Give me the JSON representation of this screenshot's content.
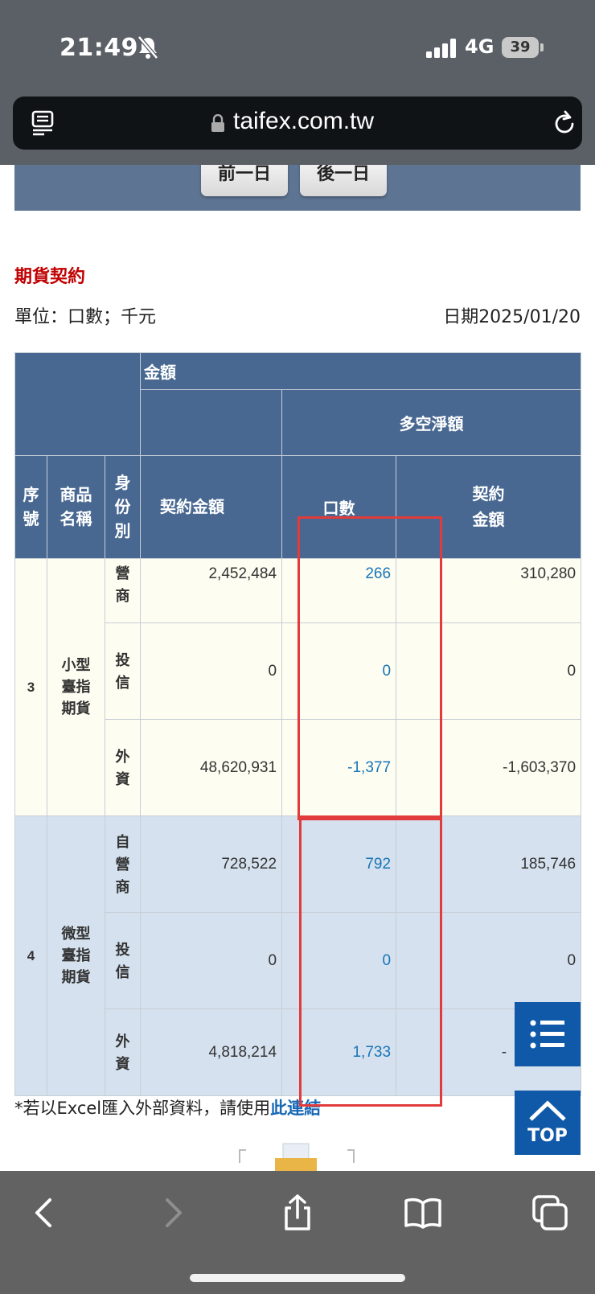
{
  "status": {
    "time": "21:49",
    "network": "4G",
    "battery": "39"
  },
  "browser": {
    "url": "taifex.com.tw"
  },
  "nav": {
    "prev_label": "前一日",
    "next_label": "後一日"
  },
  "page": {
    "section_title": "期貨契約",
    "unit_label": "單位：口數；千元",
    "date_label": "日期2025/01/20"
  },
  "table": {
    "header": {
      "amount": "金額",
      "net": "多空淨額",
      "seq": "序號",
      "product": "商品名稱",
      "identity": "身份別",
      "contract_amount": "契約金額",
      "lots": "口數",
      "net_contract_amount": "契約金額"
    },
    "groups": [
      {
        "seq": "3",
        "name": "小型臺指期貨",
        "rows": [
          {
            "identity": "營商",
            "amount": "2,452,484",
            "lots": "266",
            "net_amount": "310,280"
          },
          {
            "identity": "投信",
            "amount": "0",
            "lots": "0",
            "net_amount": "0"
          },
          {
            "identity": "外資",
            "amount": "48,620,931",
            "lots": "-1,377",
            "net_amount": "-1,603,370"
          }
        ]
      },
      {
        "seq": "4",
        "name": "微型臺指期貨",
        "rows": [
          {
            "identity": "自營商",
            "amount": "728,522",
            "lots": "792",
            "net_amount": "185,746"
          },
          {
            "identity": "投信",
            "amount": "0",
            "lots": "0",
            "net_amount": "0"
          },
          {
            "identity": "外資",
            "amount": "4,818,214",
            "lots": "1,733",
            "net_amount": "-"
          }
        ]
      }
    ]
  },
  "footnote": {
    "text": "*若以Excel匯入外部資料，請使用",
    "link": "此連結"
  },
  "fab": {
    "top_label": "TOP"
  }
}
